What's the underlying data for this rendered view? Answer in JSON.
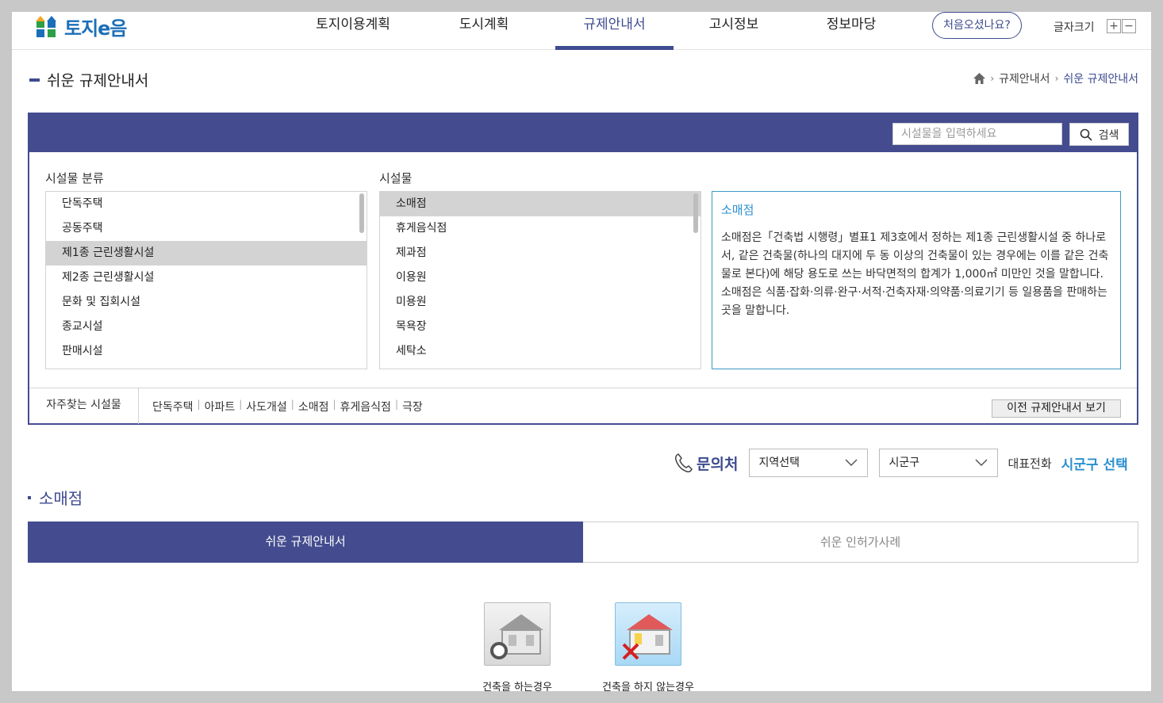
{
  "header": {
    "logo_text": "토지e음",
    "nav": [
      {
        "label": "토지이용계획"
      },
      {
        "label": "도시계획"
      },
      {
        "label": "규제안내서",
        "active": true
      },
      {
        "label": "고시정보"
      },
      {
        "label": "정보마당"
      }
    ],
    "first_visit_label": "처음오셨나요?",
    "font_size_label": "글자크기",
    "font_plus": "+",
    "font_minus": "−"
  },
  "page": {
    "title": "쉬운 규제안내서",
    "breadcrumb": [
      "규제안내서",
      "쉬운 규제안내서"
    ]
  },
  "guide": {
    "search_placeholder": "시설물을 입력하세요",
    "search_button": "검색",
    "category_label": "시설물 분류",
    "facility_label": "시설물",
    "categories": [
      {
        "label": "단독주택"
      },
      {
        "label": "공동주택"
      },
      {
        "label": "제1종 근린생활시설",
        "selected": true
      },
      {
        "label": "제2종 근린생활시설"
      },
      {
        "label": "문화 및 집회시설"
      },
      {
        "label": "종교시설"
      },
      {
        "label": "판매시설"
      }
    ],
    "facilities": [
      {
        "label": "소매점",
        "selected": true
      },
      {
        "label": "휴게음식점"
      },
      {
        "label": "제과점"
      },
      {
        "label": "이용원"
      },
      {
        "label": "미용원"
      },
      {
        "label": "목욕장"
      },
      {
        "label": "세탁소"
      }
    ],
    "description": {
      "title": "소매점",
      "body": "소매점은「건축법 시행령」별표1 제3호에서 정하는 제1종 근린생활시설 중 하나로서, 같은 건축물(하나의 대지에 두 동 이상의 건축물이 있는 경우에는 이를 같은 건축물로 본다)에 해당 용도로 쓰는 바닥면적의 합계가 1,000㎡ 미만인 것을 말합니다.\n소매점은 식품·잡화·의류·완구·서적·건축자재·의약품·의료기기 등 일용품을 판매하는 곳을 말합니다."
    },
    "favorites_label": "자주찾는 시설물",
    "favorites": [
      "단독주택",
      "아파트",
      "사도개설",
      "소매점",
      "휴게음식점",
      "극장"
    ],
    "prev_guide_button": "이전 규제안내서 보기"
  },
  "contact": {
    "label": "문의처",
    "region_select": "지역선택",
    "district_select": "시군구",
    "rep_phone_label": "대표전화",
    "rep_phone_value": "시군구 선택"
  },
  "section": {
    "title": "소매점",
    "tabs": [
      {
        "label": "쉬운 규제안내서",
        "active": true
      },
      {
        "label": "쉬운 인허가사례"
      }
    ],
    "cases": [
      {
        "label": "건축을 하는경우",
        "icon": "house-circle-icon"
      },
      {
        "label": "건축을 하지 않는경우",
        "icon": "house-x-icon"
      }
    ]
  },
  "colors": {
    "primary": "#444c8f",
    "accent_blue": "#2b8fcf",
    "border_blue": "#3b9bc8"
  }
}
